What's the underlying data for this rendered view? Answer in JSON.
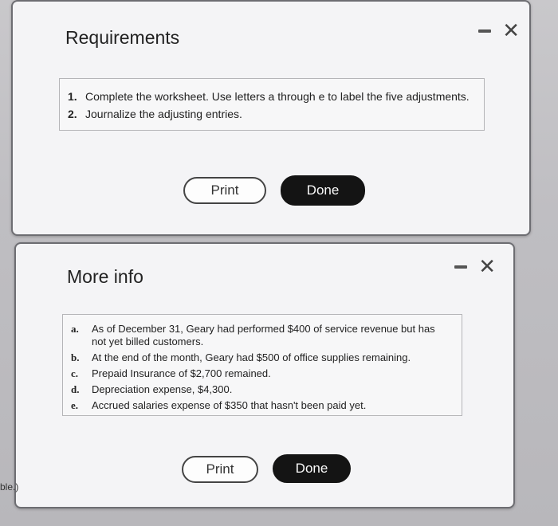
{
  "requirements_dialog": {
    "title": "Requirements",
    "items": [
      {
        "num": "1.",
        "text": "Complete the worksheet. Use letters a through e to label the five adjustments."
      },
      {
        "num": "2.",
        "text": "Journalize the adjusting entries."
      }
    ],
    "print_label": "Print",
    "done_label": "Done",
    "minimize_icon": "minimize-icon",
    "close_glyph": "✕"
  },
  "more_info_dialog": {
    "title": "More info",
    "items": [
      {
        "letter": "a.",
        "text": "As of December 31, Geary had performed $400 of service revenue but has not yet billed customers."
      },
      {
        "letter": "b.",
        "text": "At the end of the month, Geary had $500 of office supplies remaining."
      },
      {
        "letter": "c.",
        "text": "Prepaid Insurance of $2,700 remained."
      },
      {
        "letter": "d.",
        "text": "Depreciation expense, $4,300."
      },
      {
        "letter": "e.",
        "text": "Accrued salaries expense of $350 that hasn't been paid yet."
      }
    ],
    "print_label": "Print",
    "done_label": "Done",
    "close_glyph": "✕"
  },
  "background": {
    "partial_text": "ble.)"
  }
}
